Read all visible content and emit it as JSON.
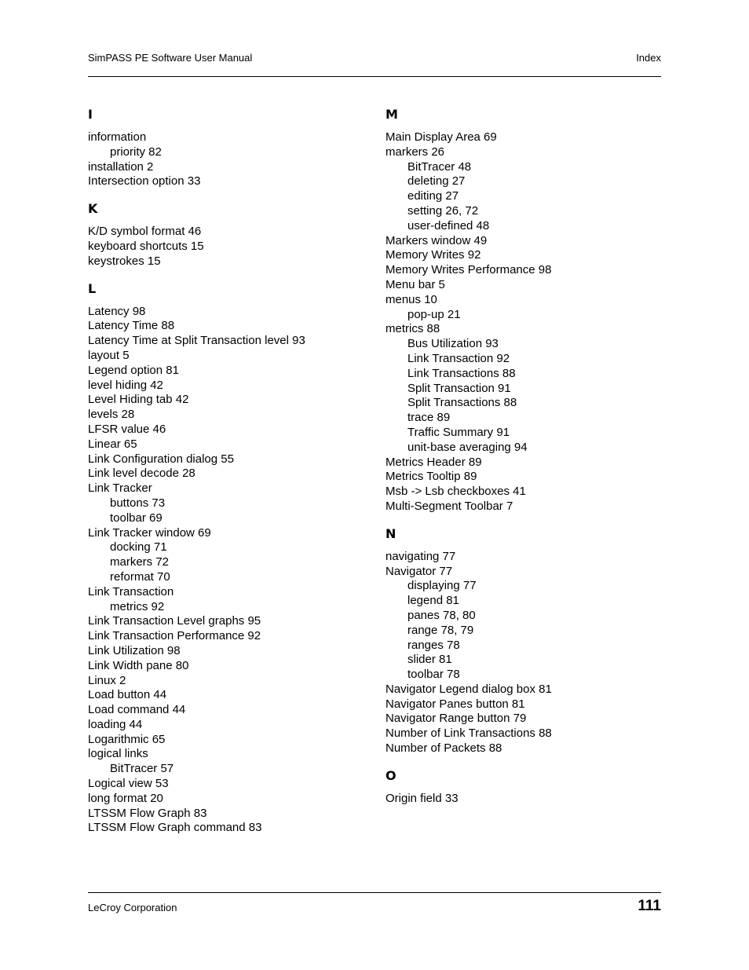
{
  "header": {
    "title": "SimPASS PE Software User Manual",
    "section": "Index"
  },
  "footer": {
    "company": "LeCroy Corporation",
    "page_number": "111"
  },
  "columns": [
    {
      "sections": [
        {
          "letter": "I",
          "entries": [
            {
              "text": "information",
              "sub": false
            },
            {
              "text": "priority 82",
              "sub": true
            },
            {
              "text": "installation 2",
              "sub": false
            },
            {
              "text": "Intersection option 33",
              "sub": false
            }
          ]
        },
        {
          "letter": "K",
          "entries": [
            {
              "text": "K/D symbol format 46",
              "sub": false
            },
            {
              "text": "keyboard shortcuts 15",
              "sub": false
            },
            {
              "text": "keystrokes 15",
              "sub": false
            }
          ]
        },
        {
          "letter": "L",
          "entries": [
            {
              "text": "Latency 98",
              "sub": false
            },
            {
              "text": "Latency Time 88",
              "sub": false
            },
            {
              "text": "Latency Time at Split Transaction level 93",
              "sub": false
            },
            {
              "text": "layout 5",
              "sub": false
            },
            {
              "text": "Legend option 81",
              "sub": false
            },
            {
              "text": "level hiding 42",
              "sub": false
            },
            {
              "text": "Level Hiding tab 42",
              "sub": false
            },
            {
              "text": "levels 28",
              "sub": false
            },
            {
              "text": "LFSR value 46",
              "sub": false
            },
            {
              "text": "Linear 65",
              "sub": false
            },
            {
              "text": "Link Configuration dialog 55",
              "sub": false
            },
            {
              "text": "Link level decode 28",
              "sub": false
            },
            {
              "text": "Link Tracker",
              "sub": false
            },
            {
              "text": "buttons 73",
              "sub": true
            },
            {
              "text": "toolbar 69",
              "sub": true
            },
            {
              "text": "Link Tracker window 69",
              "sub": false
            },
            {
              "text": "docking 71",
              "sub": true
            },
            {
              "text": "markers 72",
              "sub": true
            },
            {
              "text": "reformat 70",
              "sub": true
            },
            {
              "text": "Link Transaction",
              "sub": false
            },
            {
              "text": "metrics 92",
              "sub": true
            },
            {
              "text": "Link Transaction Level graphs 95",
              "sub": false
            },
            {
              "text": "Link Transaction Performance 92",
              "sub": false
            },
            {
              "text": "Link Utilization 98",
              "sub": false
            },
            {
              "text": "Link Width pane 80",
              "sub": false
            },
            {
              "text": "Linux 2",
              "sub": false
            },
            {
              "text": "Load button 44",
              "sub": false
            },
            {
              "text": "Load command 44",
              "sub": false
            },
            {
              "text": "loading 44",
              "sub": false
            },
            {
              "text": "Logarithmic 65",
              "sub": false
            },
            {
              "text": "logical links",
              "sub": false
            },
            {
              "text": "BitTracer 57",
              "sub": true
            },
            {
              "text": "Logical view 53",
              "sub": false
            },
            {
              "text": "long format 20",
              "sub": false
            },
            {
              "text": "LTSSM Flow Graph 83",
              "sub": false
            },
            {
              "text": "LTSSM Flow Graph command 83",
              "sub": false
            }
          ]
        }
      ]
    },
    {
      "sections": [
        {
          "letter": "M",
          "entries": [
            {
              "text": "Main Display Area 69",
              "sub": false
            },
            {
              "text": "markers 26",
              "sub": false
            },
            {
              "text": "BitTracer 48",
              "sub": true
            },
            {
              "text": "deleting 27",
              "sub": true
            },
            {
              "text": "editing 27",
              "sub": true
            },
            {
              "text": "setting 26, 72",
              "sub": true
            },
            {
              "text": "user-defined 48",
              "sub": true
            },
            {
              "text": "Markers window 49",
              "sub": false
            },
            {
              "text": "Memory Writes 92",
              "sub": false
            },
            {
              "text": "Memory Writes Performance 98",
              "sub": false
            },
            {
              "text": "Menu bar 5",
              "sub": false
            },
            {
              "text": "menus 10",
              "sub": false
            },
            {
              "text": "pop-up 21",
              "sub": true
            },
            {
              "text": "metrics 88",
              "sub": false
            },
            {
              "text": "Bus Utilization 93",
              "sub": true
            },
            {
              "text": "Link Transaction 92",
              "sub": true
            },
            {
              "text": "Link Transactions 88",
              "sub": true
            },
            {
              "text": "Split Transaction 91",
              "sub": true
            },
            {
              "text": "Split Transactions 88",
              "sub": true
            },
            {
              "text": "trace 89",
              "sub": true
            },
            {
              "text": "Traffic Summary 91",
              "sub": true
            },
            {
              "text": "unit-base averaging 94",
              "sub": true
            },
            {
              "text": "Metrics Header 89",
              "sub": false
            },
            {
              "text": "Metrics Tooltip 89",
              "sub": false
            },
            {
              "text": "Msb -> Lsb checkboxes 41",
              "sub": false
            },
            {
              "text": "Multi-Segment Toolbar 7",
              "sub": false
            }
          ]
        },
        {
          "letter": "N",
          "entries": [
            {
              "text": "navigating 77",
              "sub": false
            },
            {
              "text": "Navigator 77",
              "sub": false
            },
            {
              "text": "displaying 77",
              "sub": true
            },
            {
              "text": "legend 81",
              "sub": true
            },
            {
              "text": "panes 78, 80",
              "sub": true
            },
            {
              "text": "range 78, 79",
              "sub": true
            },
            {
              "text": "ranges 78",
              "sub": true
            },
            {
              "text": "slider 81",
              "sub": true
            },
            {
              "text": "toolbar 78",
              "sub": true
            },
            {
              "text": "Navigator Legend dialog box 81",
              "sub": false
            },
            {
              "text": "Navigator Panes button 81",
              "sub": false
            },
            {
              "text": "Navigator Range button 79",
              "sub": false
            },
            {
              "text": "Number of Link Transactions 88",
              "sub": false
            },
            {
              "text": "Number of Packets 88",
              "sub": false
            }
          ]
        },
        {
          "letter": "O",
          "entries": [
            {
              "text": "Origin field 33",
              "sub": false
            }
          ]
        }
      ]
    }
  ]
}
